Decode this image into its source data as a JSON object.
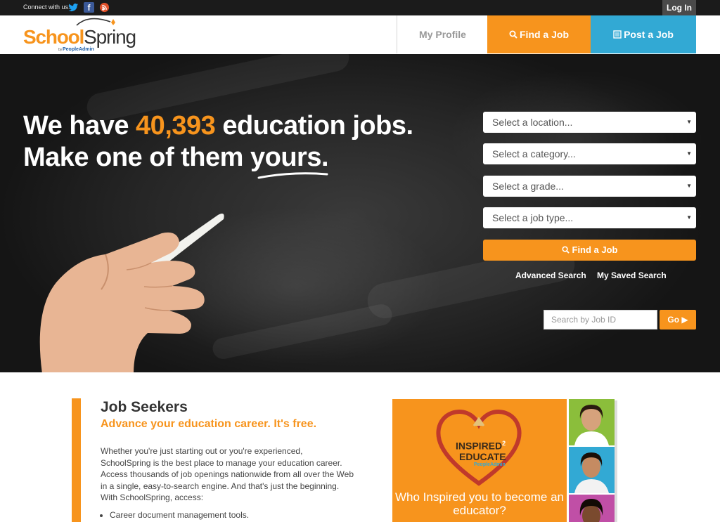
{
  "topbar": {
    "connect_label": "Connect with us:",
    "social": [
      "twitter-icon",
      "facebook-icon",
      "rss-icon"
    ],
    "login_label": "Log In"
  },
  "header": {
    "logo_text_school": "School",
    "logo_text_spring": "Spring",
    "logo_by": "by",
    "logo_partner": "PeopleAdmin",
    "nav": {
      "profile": "My Profile",
      "find": "Find a Job",
      "post": "Post a Job"
    }
  },
  "hero": {
    "line1_a": "We have ",
    "job_count": "40,393",
    "line1_b": " education jobs.",
    "line2": "Make one of them yours."
  },
  "search": {
    "location": "Select a location...",
    "category": "Select a category...",
    "grade": "Select a grade...",
    "job_type": "Select a job type...",
    "find_label": "Find a Job",
    "advanced": "Advanced Search",
    "saved": "My Saved Search",
    "jobid_placeholder": "Search by Job ID",
    "go_label": "Go"
  },
  "seekers": {
    "title": "Job Seekers",
    "subtitle": "Advance your education career. It's free.",
    "body": "Whether you're just starting out or you're experienced, SchoolSpring is the best place to manage your education career. Access thousands of job openings nationwide from all over the Web in a single, easy-to-search engine. And that's just the beginning. With SchoolSpring, access:",
    "list": [
      "Career document management tools."
    ]
  },
  "ad": {
    "logo_line1": "INSPIRED",
    "logo_sup": "2",
    "logo_line2": "EDUCATE",
    "logo_partner": "PeopleAdmin",
    "text": "Who Inspired you to become an educator?"
  },
  "colors": {
    "orange": "#f7941d",
    "blue": "#32a9d4",
    "dark": "#1b1b1b"
  }
}
